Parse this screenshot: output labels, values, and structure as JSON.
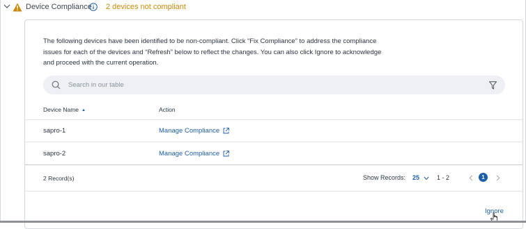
{
  "header": {
    "title": "Device Compliance",
    "status": "2 devices not compliant"
  },
  "panel": {
    "description": "The following devices have been identified to be non-compliant. Click “Fix Compliance” to address the compliance issues for each of the devices and “Refresh” below to reflect the changes. You can also click Ignore to acknowledge and proceed with the current operation.",
    "search_placeholder": "Search in our table",
    "columns": [
      "Device Name",
      "Action"
    ],
    "rows": [
      {
        "name": "sapro-1",
        "action": "Manage Compliance"
      },
      {
        "name": "sapro-2",
        "action": "Manage Compliance"
      }
    ]
  },
  "footer": {
    "records": "2 Record(s)",
    "show_records_label": "Show Records:",
    "page_size": "25",
    "range": "1 - 2",
    "current_page": "1"
  },
  "actions": {
    "ignore": "Ignore"
  },
  "colors": {
    "warning": "#c98a08",
    "link": "#1d5ea8"
  }
}
